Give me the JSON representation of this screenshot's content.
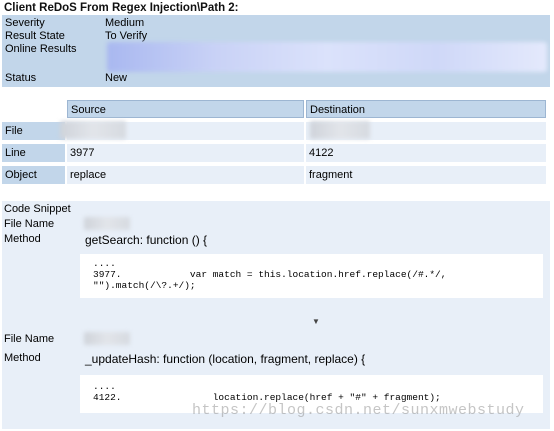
{
  "title": "Client ReDoS From Regex Injection\\Path 2:",
  "summary": {
    "severity_label": "Severity",
    "severity_value": "Medium",
    "state_label": "Result State",
    "state_value": "To Verify",
    "online_label": "Online Results",
    "status_label": "Status",
    "status_value": "New"
  },
  "table": {
    "col_source": "Source",
    "col_destination": "Destination",
    "rows": [
      {
        "label": "File",
        "source": "",
        "destination": ""
      },
      {
        "label": "Line",
        "source": "3977",
        "destination": "4122"
      },
      {
        "label": "Object",
        "source": "replace",
        "destination": "fragment"
      }
    ]
  },
  "snippet": {
    "heading": "Code Snippet",
    "file_name_label": "File Name",
    "method_label": "Method",
    "method1": "getSearch: function () {",
    "code1": "....\n3977.            var match = this.location.href.replace(/#.*/,\n\"\").match(/\\?.+/);",
    "arrow": "▼",
    "method2": "_updateHash: function (location, fragment, replace) {",
    "code2": "....\n4122.                location.replace(href + \"#\" + fragment);"
  },
  "watermark": "https://blog.csdn.net/sunxmwebstudy"
}
